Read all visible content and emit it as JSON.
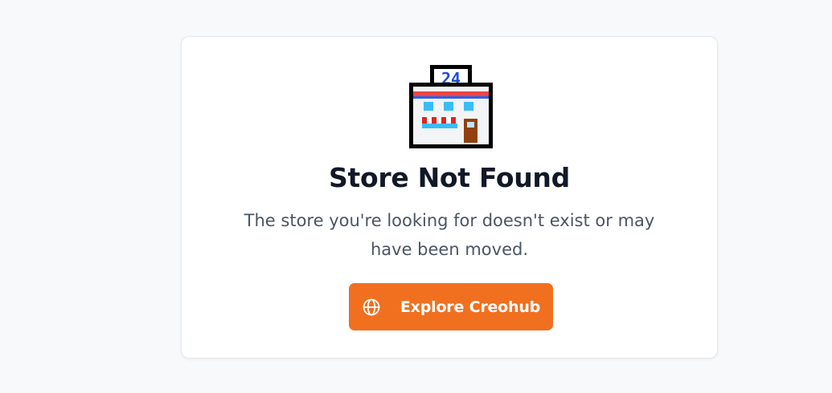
{
  "page": {
    "background_color": "#f8f9fb"
  },
  "card": {
    "icon": "convenience-store-icon",
    "icon_sign_text": "24",
    "title": "Store Not Found",
    "message": "The store you're looking for doesn't exist or may have been moved.",
    "button": {
      "label": "Explore Creohub",
      "icon": "globe-icon",
      "color": "#f07020"
    }
  }
}
